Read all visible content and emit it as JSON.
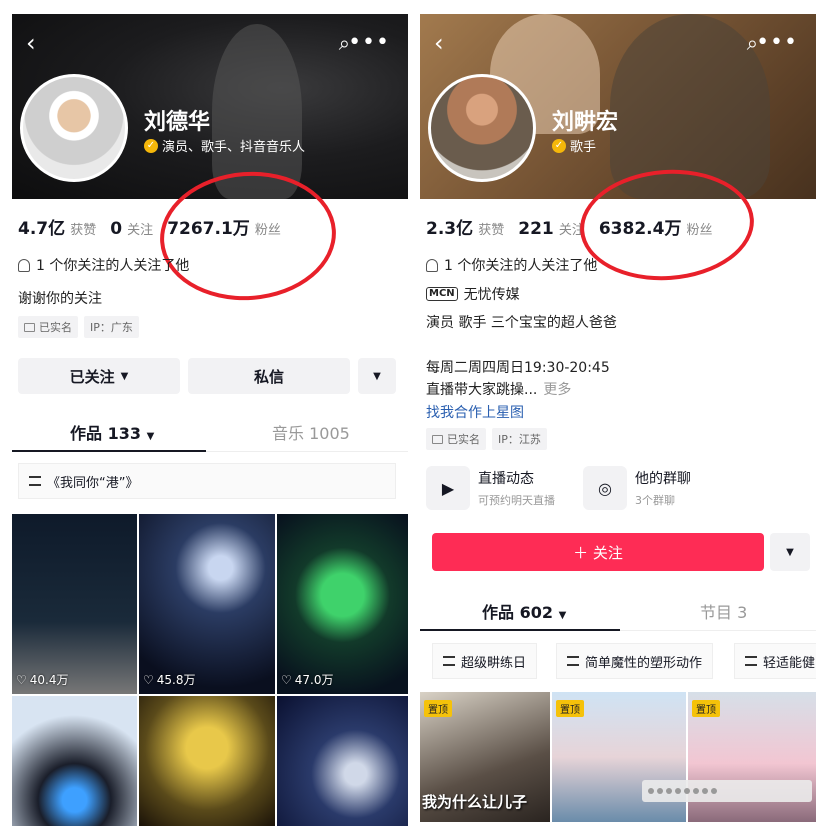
{
  "left": {
    "header": {
      "back_icon": "‹",
      "search_icon": "⌕",
      "more_icon": "•••"
    },
    "name": "刘德华",
    "tags": "演员、歌手、抖音音乐人",
    "stats": [
      {
        "num": "4.7亿",
        "label": "获赞"
      },
      {
        "num": "0",
        "label": "关注"
      },
      {
        "num": "7267.1万",
        "label": "粉丝"
      }
    ],
    "mutual": "1 个你关注的人关注了他",
    "bio": "谢谢你的关注",
    "chips": [
      "已实名",
      "IP：广东"
    ],
    "follow_button": "已关注",
    "message_button": "私信",
    "tabs": {
      "works": "作品 133",
      "music": "音乐 1005"
    },
    "collection": "《我同你“港”》",
    "videos": [
      {
        "likes": "40.4万"
      },
      {
        "likes": "45.8万"
      },
      {
        "likes": "47.0万"
      },
      {
        "likes": ""
      },
      {
        "likes": ""
      },
      {
        "likes": ""
      }
    ]
  },
  "right": {
    "header": {
      "back_icon": "‹",
      "search_icon": "⌕",
      "more_icon": "•••"
    },
    "name": "刘畊宏",
    "tags": "歌手",
    "stats": [
      {
        "num": "2.3亿",
        "label": "获赞"
      },
      {
        "num": "221",
        "label": "关注"
      },
      {
        "num": "6382.4万",
        "label": "粉丝"
      }
    ],
    "mutual": "1 个你关注的人关注了他",
    "mcn_label": "MCN",
    "mcn": "无忧传媒",
    "bio": "演员 歌手 三个宝宝的超人爸爸",
    "schedule": "每周二周四周日19:30-20:45",
    "live_note": "直播带大家跳操...",
    "more": "更多",
    "cooperate": "找我合作上星图",
    "chips": [
      "已实名",
      "IP：江苏"
    ],
    "services": [
      {
        "title": "直播动态",
        "sub": "可预约明天直播"
      },
      {
        "title": "他的群聊",
        "sub": "3个群聊"
      }
    ],
    "follow_button": "＋ 关注",
    "tabs": {
      "works": "作品 602",
      "shows": "节目 3"
    },
    "collections": [
      "超级畊练日",
      "简单魔性的塑形动作",
      "轻适能健"
    ],
    "videos": [
      {
        "pin": "置顶",
        "caption": "我为什么让儿子"
      },
      {
        "pin": "置顶",
        "caption": ""
      },
      {
        "pin": "置顶",
        "caption": ""
      }
    ]
  },
  "colors": {
    "accent_red": "#fe2c55",
    "circle_red": "#e8202a",
    "verified": "#f5b70a"
  }
}
